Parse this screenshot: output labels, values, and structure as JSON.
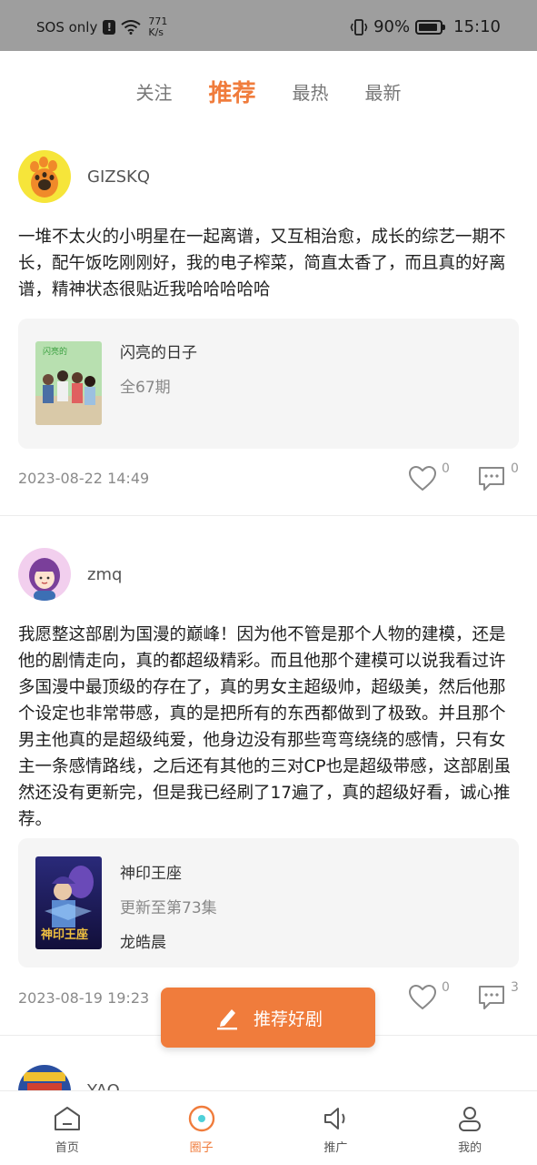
{
  "status_bar": {
    "carrier": "SOS only",
    "net_speed_value": "771",
    "net_speed_unit": "K/s",
    "battery": "90%",
    "battery_level": 0.9,
    "time": "15:10"
  },
  "tabs": [
    {
      "label": "关注",
      "active": false
    },
    {
      "label": "推荐",
      "active": true
    },
    {
      "label": "最热",
      "active": false
    },
    {
      "label": "最新",
      "active": false
    }
  ],
  "posts": [
    {
      "username": "GIZSKQ",
      "text": "一堆不太火的小明星在一起离谱，又互相治愈，成长的综艺一期不长，配午饭吃刚刚好，我的电子榨菜，简直太香了，而且真的好离谱，精神状态很贴近我哈哈哈哈哈",
      "card": {
        "title": "闪亮的日子",
        "subtitle": "全67期"
      },
      "time": "2023-08-22 14:49",
      "likes": "0",
      "comments": "0"
    },
    {
      "username": "zmq",
      "text": "我愿整这部剧为国漫的巅峰！因为他不管是那个人物的建模，还是他的剧情走向，真的都超级精彩。而且他那个建模可以说我看过许多国漫中最顶级的存在了，真的男女主超级帅，超级美，然后他那个设定也非常带感，真的是把所有的东西都做到了极致。并且那个男主他真的是超级纯爱，他身边没有那些弯弯绕绕的感情，只有女主一条感情路线，之后还有其他的三对CP也是超级带感，这部剧虽然还没有更新完，但是我已经刷了17遍了，真的超级好看，诚心推荐。",
      "card": {
        "title": "神印王座",
        "subtitle": "更新至第73集",
        "extra": "龙皓晨"
      },
      "time": "2023-08-19 19:23",
      "likes": "0",
      "comments": "3"
    },
    {
      "username": "YAO"
    }
  ],
  "fab": {
    "label": "推荐好剧",
    "icon": "pencil-icon"
  },
  "bottom_nav": [
    {
      "label": "首页",
      "icon": "home-icon",
      "active": false
    },
    {
      "label": "圈子",
      "icon": "circle-icon",
      "active": true
    },
    {
      "label": "推广",
      "icon": "speaker-icon",
      "active": false
    },
    {
      "label": "我的",
      "icon": "profile-icon",
      "active": false
    }
  ],
  "colors": {
    "accent": "#f07c3c",
    "status_bar": "#9e9e9e",
    "card_bg": "#f5f5f5"
  }
}
